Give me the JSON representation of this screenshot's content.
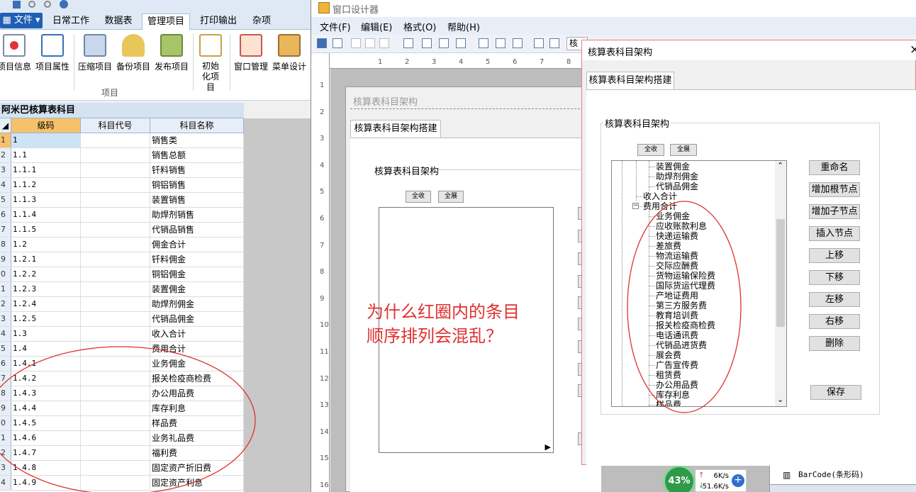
{
  "left_app": {
    "ribbon_tabs": [
      "文件",
      "日常工作",
      "数据表",
      "管理项目",
      "打印输出",
      "杂项"
    ],
    "ribbon_buttons": [
      "项目信息",
      "项目属性",
      "压缩项目",
      "备份项目",
      "发布项目",
      "初始化项目",
      "窗口管理",
      "菜单设计"
    ],
    "ribbon_group": "项目",
    "grid_title": "阿米巴核算表科目",
    "columns": [
      "级码",
      "科目代号",
      "科目名称"
    ],
    "rows": [
      [
        "1",
        "1",
        "销售类"
      ],
      [
        "2",
        "1.1",
        "销售总额"
      ],
      [
        "3",
        "1.1.1",
        "钎料销售"
      ],
      [
        "4",
        "1.1.2",
        "铜铝销售"
      ],
      [
        "5",
        "1.1.3",
        "装置销售"
      ],
      [
        "6",
        "1.1.4",
        "助焊剂销售"
      ],
      [
        "7",
        "1.1.5",
        "代销品销售"
      ],
      [
        "8",
        "1.2",
        "佣金合计"
      ],
      [
        "9",
        "1.2.1",
        "钎料佣金"
      ],
      [
        "0",
        "1.2.2",
        "铜铝佣金"
      ],
      [
        "1",
        "1.2.3",
        "装置佣金"
      ],
      [
        "2",
        "1.2.4",
        "助焊剂佣金"
      ],
      [
        "3",
        "1.2.5",
        "代销品佣金"
      ],
      [
        "4",
        "1.3",
        "收入合计"
      ],
      [
        "5",
        "1.4",
        "费用合计"
      ],
      [
        "6",
        "1.4.1",
        "业务佣金"
      ],
      [
        "7",
        "1.4.2",
        "报关检疫商检费"
      ],
      [
        "8",
        "1.4.3",
        "办公用品费"
      ],
      [
        "9",
        "1.4.4",
        "库存利息"
      ],
      [
        "0",
        "1.4.5",
        "样品费"
      ],
      [
        "1",
        "1.4.6",
        "业务礼品费"
      ],
      [
        "2",
        "1.4.7",
        "福利费"
      ],
      [
        "3",
        "1.4.8",
        "固定资产折旧费"
      ],
      [
        "4",
        "1.4.9",
        "固定资产利息"
      ]
    ]
  },
  "designer": {
    "title": "窗口设计器",
    "menus": [
      "文件(F)",
      "编辑(E)",
      "格式(O)",
      "帮助(H)"
    ],
    "toolbar_trailing_text": "核",
    "ruler_top": [
      "1",
      "2",
      "3",
      "4",
      "5",
      "6",
      "7",
      "8"
    ],
    "ruler_left": [
      "1",
      "2",
      "3",
      "4",
      "5",
      "6",
      "7",
      "8",
      "9",
      "10",
      "11",
      "12",
      "13",
      "14",
      "15",
      "16"
    ],
    "inner_form": {
      "title": "核算表科目架构",
      "tab": "核算表科目架构搭建",
      "group": "核算表科目架构",
      "collapse": "全收",
      "expand": "全展"
    }
  },
  "question": {
    "line1": "为什么红圈内的条目",
    "line2": "顺序排列会混乱？"
  },
  "dialog": {
    "title": "核算表科目架构",
    "close": "×",
    "tab": "核算表科目架构搭建",
    "group": "核算表科目架构",
    "collapse": "全收",
    "expand": "全展",
    "tree": [
      "装置佣金",
      "助焊剂佣金",
      "代销品佣金",
      "收入合计",
      "费用合计",
      "业务佣金",
      "应收账款利息",
      "快递运输费",
      "差旅费",
      "物流运输费",
      "交际应酬费",
      "货物运输保险费",
      "国际货运代理费",
      "产地证费用",
      "第三方服务费",
      "教育培训费",
      "报关检疫商检费",
      "电话通讯费",
      "代销品进货费",
      "展会费",
      "广告宣传费",
      "租赁费",
      "办公用品费",
      "库存利息",
      "样品费"
    ],
    "buttons": [
      "重命名",
      "增加根节点",
      "增加子节点",
      "插入节点",
      "上移",
      "下移",
      "左移",
      "右移",
      "删除"
    ],
    "save": "保存"
  },
  "bottom": {
    "cpu_percent": "43%",
    "upload": "6K/s",
    "download": "51.6K/s",
    "toolbox_item": "BarCode(条形码)"
  },
  "colors": {
    "annotation_red": "#e03030",
    "ribbon_blue": "#1f5fb5"
  }
}
